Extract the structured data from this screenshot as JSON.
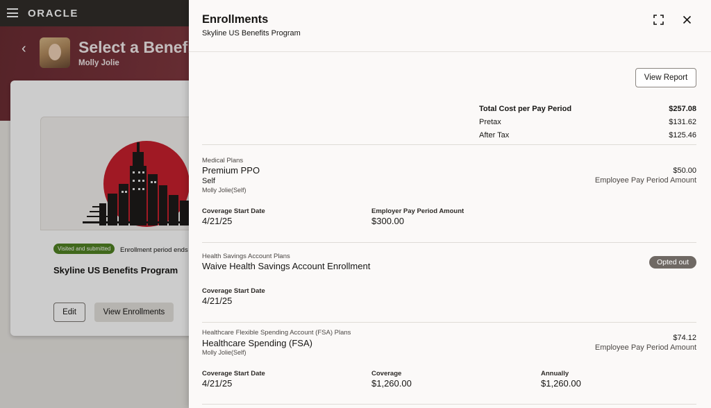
{
  "app": {
    "brand": "ORACLE"
  },
  "background": {
    "page_title": "Select a Benefit",
    "person_name": "Molly Jolie",
    "card": {
      "badge": "Visited and submitted",
      "period_text": "Enrollment period ends",
      "title": "Skyline US Benefits Program",
      "edit_label": "Edit",
      "view_enrollments_label": "View Enrollments"
    }
  },
  "drawer": {
    "title": "Enrollments",
    "subtitle": "Skyline US Benefits Program",
    "view_report_label": "View Report",
    "totals": {
      "total_label": "Total Cost per Pay Period",
      "total_value": "$257.08",
      "pretax_label": "Pretax",
      "pretax_value": "$131.62",
      "aftertax_label": "After Tax",
      "aftertax_value": "$125.46"
    },
    "plans": [
      {
        "category": "Medical Plans",
        "name": "Premium PPO",
        "coverage": "Self",
        "person": "Molly Jolie(Self)",
        "amount": "$50.00",
        "amount_note": "Employee Pay Period Amount",
        "coverage_start_label": "Coverage Start Date",
        "coverage_start": "4/21/25",
        "employer_label": "Employer Pay Period Amount",
        "employer_amount": "$300.00"
      },
      {
        "category": "Health Savings Account Plans",
        "name": "Waive Health Savings Account Enrollment",
        "status": "Opted out",
        "coverage_start_label": "Coverage Start Date",
        "coverage_start": "4/21/25"
      },
      {
        "category": "Healthcare Flexible Spending Account (FSA) Plans",
        "name": "Healthcare Spending (FSA)",
        "person": "Molly Jolie(Self)",
        "amount": "$74.12",
        "amount_note": "Employee Pay Period Amount",
        "coverage_start_label": "Coverage Start Date",
        "coverage_start": "4/21/25",
        "coverage_label": "Coverage",
        "coverage_value": "$1,260.00",
        "annually_label": "Annually",
        "annually_value": "$1,260.00"
      }
    ]
  }
}
